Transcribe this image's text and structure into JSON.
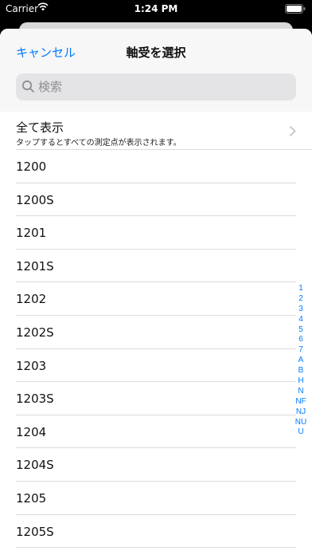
{
  "status": {
    "carrier": "Carrier",
    "time": "1:24 PM"
  },
  "nav": {
    "cancel_label": "キャンセル",
    "title": "軸受を選択"
  },
  "search": {
    "placeholder": "検索"
  },
  "show_all": {
    "title": "全て表示",
    "subtitle": "タップするとすべての測定点が表示されます。"
  },
  "items": [
    "1200",
    "1200S",
    "1201",
    "1201S",
    "1202",
    "1202S",
    "1203",
    "1203S",
    "1204",
    "1204S",
    "1205",
    "1205S"
  ],
  "index": [
    "1",
    "2",
    "3",
    "4",
    "5",
    "6",
    "7",
    "A",
    "B",
    "H",
    "N",
    "NF",
    "NJ",
    "NU",
    "U"
  ],
  "colors": {
    "accent": "#007aff",
    "nav_bg": "#f7f7f7",
    "search_bg": "#e4e4e6"
  }
}
